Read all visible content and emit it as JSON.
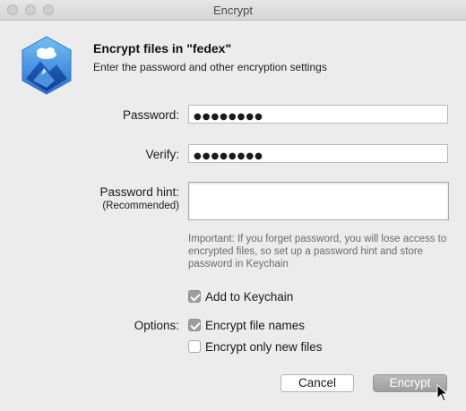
{
  "window": {
    "title": "Encrypt"
  },
  "header": {
    "title": "Encrypt files in \"fedex\"",
    "subtitle": "Enter the password and other encryption settings",
    "icon": "app-mountain-icon"
  },
  "form": {
    "password_label": "Password:",
    "password_value": "●●●●●●●●",
    "verify_label": "Verify:",
    "verify_value": "●●●●●●●●",
    "hint_label": "Password hint:",
    "hint_sublabel": "(Recommended)",
    "hint_value": "",
    "note": "Important: If you forget password, you will lose access to encrypted files, so set up a password hint and store password in Keychain"
  },
  "options": {
    "keychain_label": "Add to Keychain",
    "keychain_checked": true,
    "options_label": "Options:",
    "encrypt_names_label": "Encrypt file names",
    "encrypt_names_checked": true,
    "encrypt_new_label": "Encrypt only new files",
    "encrypt_new_checked": false
  },
  "buttons": {
    "cancel": "Cancel",
    "encrypt": "Encrypt"
  },
  "colors": {
    "window_bg": "#ececec",
    "checkbox_on": "#9e9e9e",
    "default_button": "#a8a8a8",
    "note_text": "#6b6b6b"
  }
}
